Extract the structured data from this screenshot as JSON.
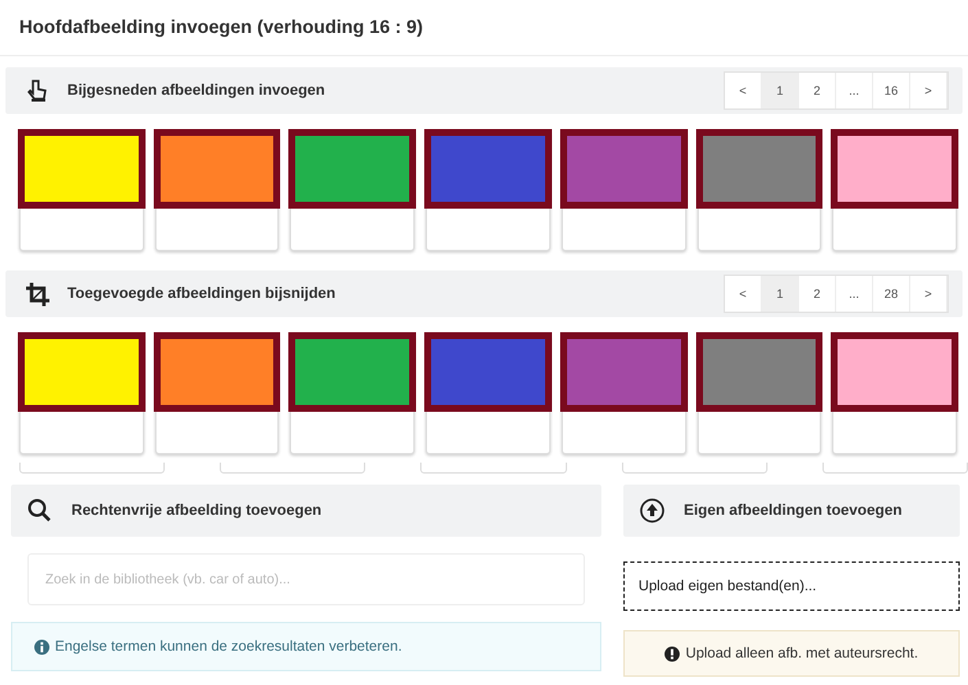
{
  "title": "Hoofdafbeelding invoegen (verhouding 16 : 9)",
  "sections": [
    {
      "kind": "pointer",
      "label": "Bijgesneden afbeeldingen invoegen",
      "pages": [
        {
          "label": "<",
          "selected": false
        },
        {
          "label": "1",
          "selected": true
        },
        {
          "label": "2",
          "selected": false
        },
        {
          "label": "...",
          "selected": false
        },
        {
          "label": "16",
          "selected": false
        },
        {
          "label": ">",
          "selected": false
        }
      ],
      "thumbnails": [
        {
          "color": "#fff200",
          "selected": true
        },
        {
          "color": "#ff7f27",
          "selected": true
        },
        {
          "color": "#22b14c",
          "selected": true
        },
        {
          "color": "#3f48cc",
          "selected": true
        },
        {
          "color": "#a349a4",
          "selected": true
        },
        {
          "color": "#7f7f7f",
          "selected": true
        },
        {
          "color": "#ffaec9",
          "selected": true
        }
      ]
    },
    {
      "kind": "crop",
      "label": "Toegevoegde afbeeldingen bijsnijden",
      "pages": [
        {
          "label": "<",
          "selected": false
        },
        {
          "label": "1",
          "selected": true
        },
        {
          "label": "2",
          "selected": false
        },
        {
          "label": "...",
          "selected": false
        },
        {
          "label": "28",
          "selected": false
        },
        {
          "label": ">",
          "selected": false
        }
      ],
      "thumbnails": [
        {
          "color": "#fff200",
          "selected": true
        },
        {
          "color": "#ff7f27",
          "selected": true
        },
        {
          "color": "#22b14c",
          "selected": true
        },
        {
          "color": "#3f48cc",
          "selected": true
        },
        {
          "color": "#a349a4",
          "selected": true
        },
        {
          "color": "#7f7f7f",
          "selected": true
        },
        {
          "color": "#ffaec9",
          "selected": true
        }
      ]
    }
  ],
  "library": {
    "label": "Rechtenvrije afbeelding toevoegen",
    "placeholder": "Zoek in de bibliotheek (vb. car of auto)...",
    "note": "Engelse termen kunnen de zoekresultaten verbeteren."
  },
  "upload": {
    "label": "Eigen afbeeldingen toevoegen",
    "button": "Upload eigen bestand(en)...",
    "note": "Upload alleen afb. met auteursrecht."
  }
}
